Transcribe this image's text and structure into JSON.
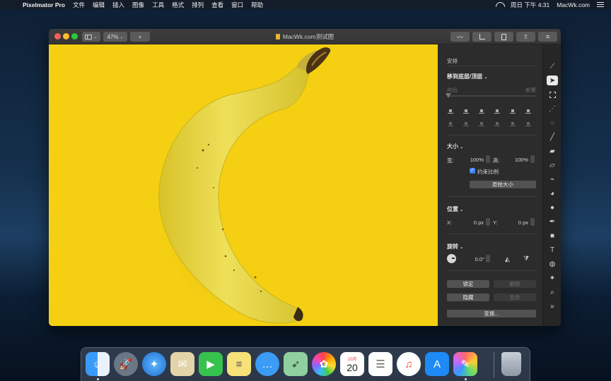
{
  "menubar": {
    "app_name": "Pixelmator Pro",
    "menus": [
      "文件",
      "编辑",
      "插入",
      "图像",
      "工具",
      "格式",
      "排列",
      "查看",
      "窗口",
      "帮助"
    ],
    "clock": "周日 下午 4:31",
    "site": "MacWk.com"
  },
  "window": {
    "zoom": "47%",
    "add_label": "+",
    "document_title": "MacWk.com测试图"
  },
  "inspector": {
    "arrange_title": "安排",
    "move_layer_label": "移到底层/顶层",
    "backward_label": "向后",
    "forward_label": "前置",
    "size": {
      "title": "大小",
      "width_label": "宽:",
      "width_value": "100%",
      "height_label": "高:",
      "height_value": "100%",
      "constrain_label": "约束比例",
      "constrain_checked": true,
      "original_size_button": "原始大小"
    },
    "position": {
      "title": "位置",
      "x_label": "X:",
      "x_value": "0 px",
      "y_label": "Y:",
      "y_value": "0 px"
    },
    "rotate": {
      "title": "旋转",
      "angle": "0.0°"
    },
    "lock_button": "锁定",
    "unlock_button": "解锁",
    "hide_button": "隐藏",
    "show_button": "显示",
    "transform_button": "变换..."
  },
  "tools": [
    "style-tool-icon",
    "arrange-tool-icon",
    "selection-tool-icon",
    "paint-selection-icon",
    "quick-selection-icon",
    "paint-brush-icon",
    "paint-bucket-icon",
    "eraser-icon",
    "repair-icon",
    "clone-icon",
    "blur-icon",
    "pen-icon",
    "shape-icon",
    "type-icon",
    "color-adjust-icon",
    "effects-icon",
    "zoom-icon",
    "more-tools-icon"
  ],
  "dock": {
    "calendar_month": "10月",
    "calendar_day": "20"
  },
  "colors": {
    "canvas_background": "#f5cf12",
    "banana": "#e8d63a",
    "accent_checkbox": "#3b82f6"
  }
}
